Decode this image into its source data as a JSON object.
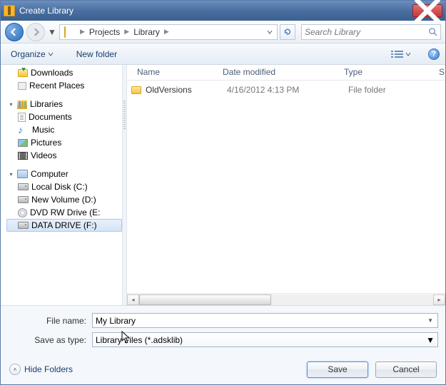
{
  "window": {
    "title": "Create Library"
  },
  "nav": {
    "breadcrumb": [
      "Projects",
      "Library"
    ],
    "search_placeholder": "Search Library"
  },
  "toolbar": {
    "organize": "Organize",
    "new_folder": "New folder"
  },
  "tree": {
    "favorites_items": [
      {
        "label": "Downloads"
      },
      {
        "label": "Recent Places"
      }
    ],
    "libraries_label": "Libraries",
    "libraries_items": [
      {
        "label": "Documents"
      },
      {
        "label": "Music"
      },
      {
        "label": "Pictures"
      },
      {
        "label": "Videos"
      }
    ],
    "computer_label": "Computer",
    "computer_items": [
      {
        "label": "Local Disk (C:)"
      },
      {
        "label": "New Volume (D:)"
      },
      {
        "label": "DVD RW Drive (E:"
      },
      {
        "label": "DATA DRIVE (F:)"
      }
    ]
  },
  "filelist": {
    "columns": {
      "name": "Name",
      "date": "Date modified",
      "type": "Type",
      "size": "S"
    },
    "rows": [
      {
        "name": "OldVersions",
        "date": "4/16/2012 4:13 PM",
        "type": "File folder"
      }
    ]
  },
  "fields": {
    "file_name_label": "File name:",
    "file_name_value": "My Library",
    "save_type_label": "Save as type:",
    "save_type_value": "Library Files (*.adsklib)"
  },
  "footer": {
    "hide_folders": "Hide Folders",
    "save": "Save",
    "cancel": "Cancel"
  }
}
